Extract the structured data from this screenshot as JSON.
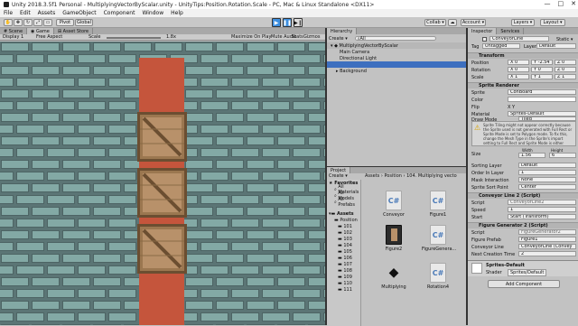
{
  "title_bar": {
    "title": "Unity 2018.3.5f1 Personal - MultiplyingVectorByScalar.unity - UnityTips:Position.Rotation.Scale - PC, Mac & Linux Standalone <DX11>",
    "controls": [
      "—",
      "□",
      "✕"
    ]
  },
  "menu": [
    "File",
    "Edit",
    "Assets",
    "GameObject",
    "Component",
    "Window",
    "Help"
  ],
  "toolbar": {
    "pivot": "Pivot",
    "global": "Global",
    "collab": "Collab ▾",
    "account": "Account ▾",
    "layers": "Layers ▾",
    "layout": "Layout ▾"
  },
  "tabs": {
    "left": [
      "Scene",
      "Game",
      "Asset Store"
    ],
    "hierarchy": "Hierarchy",
    "project": "Project",
    "inspector": [
      "Inspector",
      "Services"
    ]
  },
  "game_toolbar": {
    "display": "Display 1",
    "aspect": "Free Aspect",
    "scale_label": "Scale",
    "scale_value": "1.8x",
    "options": [
      "Maximize On Play",
      "Mute Audio",
      "Stats",
      "Gizmos"
    ]
  },
  "hierarchy": {
    "create": "Create ▾",
    "search_placeholder": "All",
    "scene": "MultiplyingVectorByScalar",
    "items": [
      "Main Camera",
      "Directional Light",
      "",
      "Background"
    ]
  },
  "project": {
    "create": "Create ▾",
    "breadcrumb": "Assets › Position › 104. Multiplying vecto",
    "favorites_label": "Favorites",
    "favorites": [
      "All Materials",
      "All Models",
      "All Prefabs"
    ],
    "tree_root": "Assets",
    "tree": [
      "Position",
      "101",
      "102",
      "103",
      "104",
      "105",
      "106",
      "107",
      "108",
      "109",
      "110",
      "111"
    ],
    "assets": [
      {
        "name": "Conveyor",
        "icon": "C#"
      },
      {
        "name": "Figure1",
        "icon": "C#"
      },
      {
        "name": "Figure2",
        "icon": "prefab"
      },
      {
        "name": "FigureGenera...",
        "icon": "C#"
      },
      {
        "name": "Multiplying",
        "icon": "unity"
      },
      {
        "name": "Rotation4",
        "icon": "C#"
      }
    ]
  },
  "inspector": {
    "object_name": "ConveyorLine",
    "static_label": "Static ▾",
    "tag_label": "Tag",
    "tag_value": "Untagged",
    "layer_label": "Layer",
    "layer_value": "Default",
    "transform": {
      "header": "Transform",
      "position_label": "Position",
      "rotation_label": "Rotation",
      "scale_label": "Scale",
      "position": [
        "X 0",
        "Y -2.54",
        "Z 0"
      ],
      "rotation": [
        "X 0",
        "Y 0",
        "Z 0"
      ],
      "scale": [
        "X 1",
        "Y 1",
        "Z 1"
      ]
    },
    "sprite_renderer": {
      "header": "Sprite Renderer",
      "sprite_label": "Sprite",
      "sprite_value": "ConBoard",
      "color_label": "Color",
      "flip_label": "Flip",
      "flip_value": "X  Y",
      "material_label": "Material",
      "material_value": "Sprites-Default",
      "draw_mode_label": "Draw Mode",
      "draw_mode_value": "Tiled",
      "warning": "Sprite Tiling might not appear correctly because the Sprite used is not generated with Full Rect or Sprite Mode is set to Polygon mode. To fix this, change the Mesh Type in the Sprite's import setting to Full Rect and Sprite Mode is either Single or Multiple",
      "size_label": "Size",
      "width_label": "Width",
      "height_label": "Height",
      "width_value": "1.56",
      "height_value": "6",
      "sorting_layer_label": "Sorting Layer",
      "sorting_layer_value": "Default",
      "order_label": "Order In Layer",
      "order_value": "1",
      "mask_label": "Mask Interaction",
      "mask_value": "None",
      "sort_point_label": "Sprite Sort Point",
      "sort_point_value": "Center"
    },
    "conveyor_script": {
      "header": "Conveyor Line 2 (Script)",
      "script_label": "Script",
      "script_value": "ConveyorLine2",
      "speed_label": "Speed",
      "speed_value": "1",
      "start_label": "Start",
      "start_value": "Start (Transform)"
    },
    "figure_script": {
      "header": "Figure Generator 2 (Script)",
      "script_label": "Script",
      "script_value": "FigureGenerator2",
      "prefab_label": "Figure Prefab",
      "prefab_value": "Figure1",
      "line_label": "Conveyor Line",
      "line_value": "ConveyorLine (Convey",
      "next_label": "Next Creation Time",
      "next_value": "2"
    },
    "material": {
      "name": "Sprites-Default",
      "shader_label": "Shader",
      "shader_value": "Sprites/Default"
    },
    "add_component": "Add Component"
  }
}
